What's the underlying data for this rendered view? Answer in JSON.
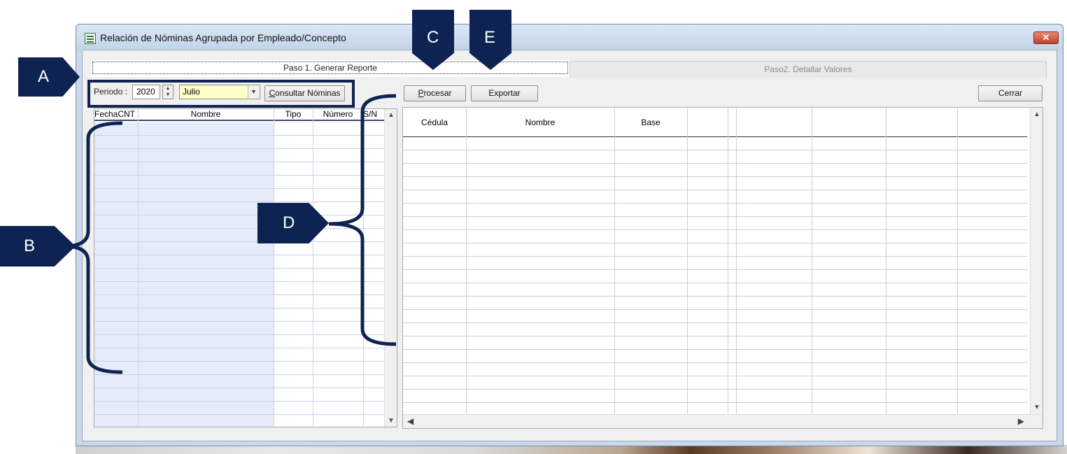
{
  "window": {
    "title": "Relación de Nóminas Agrupada por Empleado/Concepto",
    "close_label": "✕"
  },
  "tabs": [
    {
      "label": "Paso 1. Generar Reporte"
    },
    {
      "label": "Paso2. Detallar Valores"
    }
  ],
  "period": {
    "label": "Periodo :",
    "year": "2020",
    "month": "Julio",
    "consult_button": "Consultar Nóminas"
  },
  "toolbar": {
    "process_button": "Procesar",
    "export_button": "Exportar",
    "close_button": "Cerrar"
  },
  "left_grid": {
    "columns": [
      "FechaCNT",
      "Nombre",
      "Tipo",
      "Número",
      "S/N"
    ]
  },
  "right_grid": {
    "columns": [
      "Cédula",
      "Nombre",
      "Base"
    ]
  },
  "annotations": {
    "a": "A",
    "b": "B",
    "c": "C",
    "d": "D",
    "e": "E"
  },
  "colors": {
    "annotation": "#0f2352",
    "month_field": "#ffffc8",
    "grid_shade": "#e6ebfa"
  }
}
